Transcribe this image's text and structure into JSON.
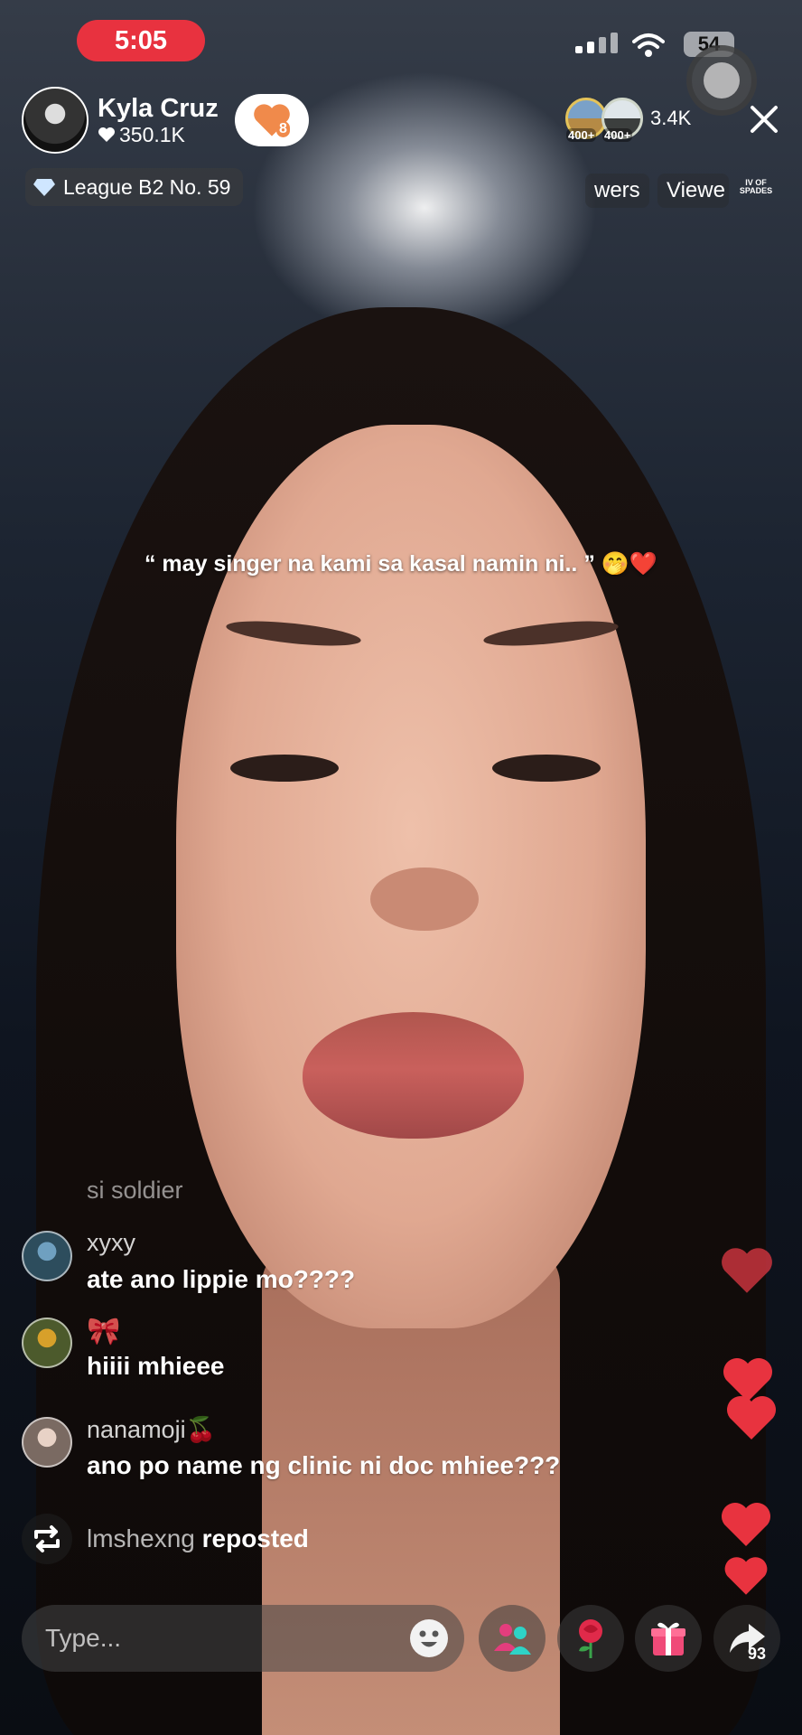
{
  "status_bar": {
    "time": "5:05",
    "battery": "54"
  },
  "host": {
    "name": "Kyla Cruz",
    "likes": "350.1K",
    "heart_count": "8"
  },
  "league": {
    "label": "League B2 No. 59"
  },
  "viewers": {
    "badge_a": "400+",
    "badge_b": "400+",
    "count": "3.4K"
  },
  "tabs": {
    "followers": "wers",
    "viewers": "Viewe",
    "spades_line1": "IV OF",
    "spades_line2": "SPADES"
  },
  "live_title": "“ may singer na kami sa kasal namin ni.. ” 🤭❤️",
  "chat": {
    "previous_fragment": "si soldier",
    "messages": [
      {
        "user": "xyxy",
        "text": "ate ano lippie mo????"
      },
      {
        "user": "🎀",
        "text": "hiiii mhieee"
      },
      {
        "user": "nanamoji🍒",
        "text": "ano po name ng clinic ni doc mhiee???"
      }
    ],
    "repost": {
      "user": "lmshexng",
      "action": "reposted"
    }
  },
  "bottom_bar": {
    "placeholder": "Type...",
    "share_count": "93"
  },
  "colors": {
    "time_pill": "#e8323f",
    "heart": "#e8333f",
    "accent_orange": "#f08a4b"
  },
  "icons": [
    "wifi-icon",
    "signal-icon",
    "heart-icon",
    "diamond-icon",
    "close-icon",
    "repost-icon",
    "emoji-icon",
    "guests-icon",
    "rose-icon",
    "gift-icon",
    "share-icon"
  ]
}
